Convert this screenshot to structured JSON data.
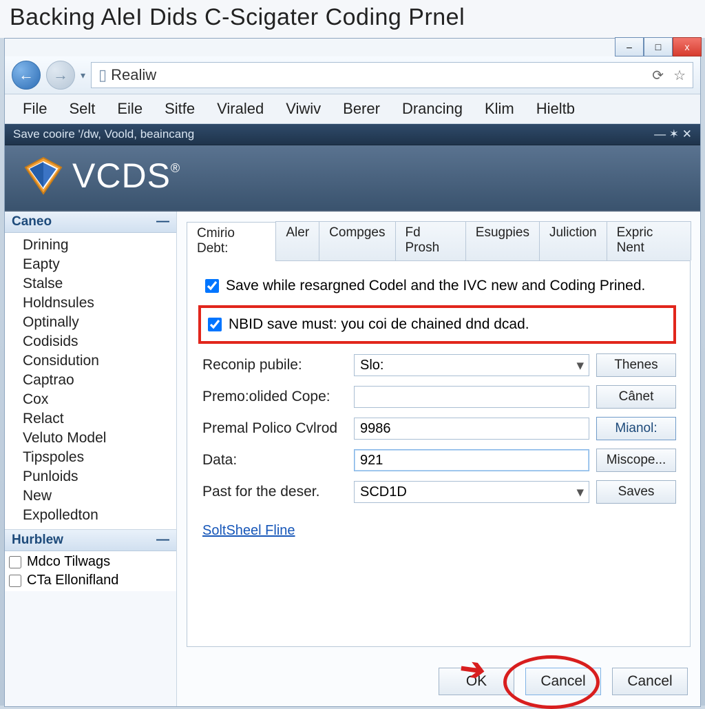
{
  "outer_title": "Backing AleI Dids C-Scigater Coding Prnel",
  "address_bar": {
    "icon": "file-icon",
    "text": "Realiw"
  },
  "window_controls": {
    "minimize": "–",
    "maximize": "□",
    "close": "x"
  },
  "menu": [
    "File",
    "Selt",
    "Eile",
    "Sitfe",
    "Viraled",
    "Viwiv",
    "Berer",
    "Drancing",
    "Klim",
    "Hieltb"
  ],
  "sub_title": "Save cooire '/dw, Voold, beaincang",
  "sub_title_controls": "—  ✶ ✕",
  "brand": "VCDS",
  "brand_reg": "®",
  "side_panels": {
    "caneo": {
      "title": "Caneo",
      "collapse": "—",
      "items": [
        "Drining",
        "Eapty",
        "Stalse",
        "Holdnsules",
        "Optinally",
        "Codisids",
        "Considution",
        "Captrao",
        "Cox",
        "Relact",
        "Veluto Model",
        "Tipspoles",
        "Punloids",
        "New",
        "Expolledton"
      ]
    },
    "hurblew": {
      "title": "Hurblew",
      "collapse": "—",
      "items": [
        "Mdco Tilwags",
        "CTa Ellonifland"
      ]
    }
  },
  "tabs": [
    "Cmirio Debt:",
    "Aler",
    "Compges",
    "Fd Prosh",
    "Esugpies",
    "Juliction",
    "Expric Nent"
  ],
  "check1": "Save while resargned Codel and the IVC new and Coding Prined.",
  "check2": "NBID save must: you coi de chained dnd dcad.",
  "form": {
    "row1_label": "Reconip pubile:",
    "row1_value": "Slo:",
    "row1_btn": "Thenes",
    "row2_label": "Premo:olided Cope:",
    "row2_value": "",
    "row2_btn": "Cânet",
    "row3_label": "Premal Polico Cvlrod",
    "row3_value": "9986",
    "row3_btn": "Mianol:",
    "row4_label": "Data:",
    "row4_value": "921",
    "row4_btn": "Miscope...",
    "row5_label": "Past for the deser.",
    "row5_value": "SCD1D",
    "row5_btn": "Saves"
  },
  "link": "SoltSheel Fline",
  "footer": {
    "ok": "OK",
    "cancel1": "Cancel",
    "cancel2": "Cancel"
  }
}
